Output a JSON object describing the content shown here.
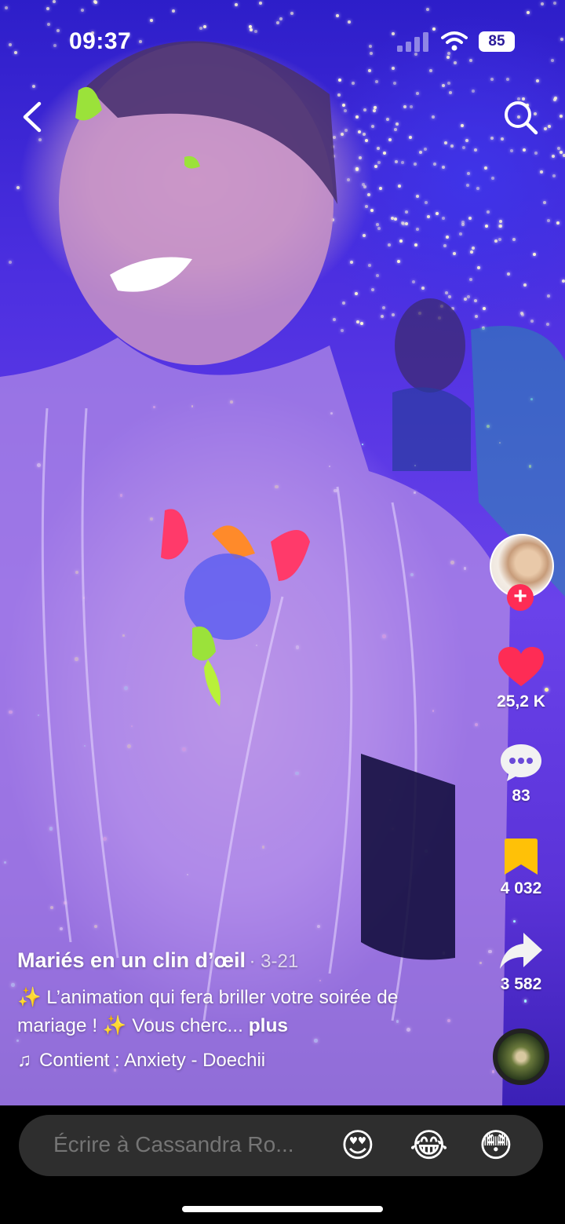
{
  "status_bar": {
    "time": "09:37",
    "battery": "85"
  },
  "actions": {
    "likes": "25,2 K",
    "comments": "83",
    "saves": "4 032",
    "shares": "3 582"
  },
  "post": {
    "author": "Mariés en un clin d’œil",
    "date": "· 3-21",
    "description": "✨ L’animation qui fera briller votre soirée de mariage ! ✨ Vous cherc...",
    "more_label": "plus",
    "music": "Contient : Anxiety - Doechii"
  },
  "comment_bar": {
    "placeholder": "Écrire à Cassandra Ro...",
    "emojis": [
      "😍",
      "😂",
      "😳"
    ]
  },
  "colors": {
    "like": "#fe2c55",
    "save": "#ffc107",
    "accent": "#fe2c55"
  }
}
